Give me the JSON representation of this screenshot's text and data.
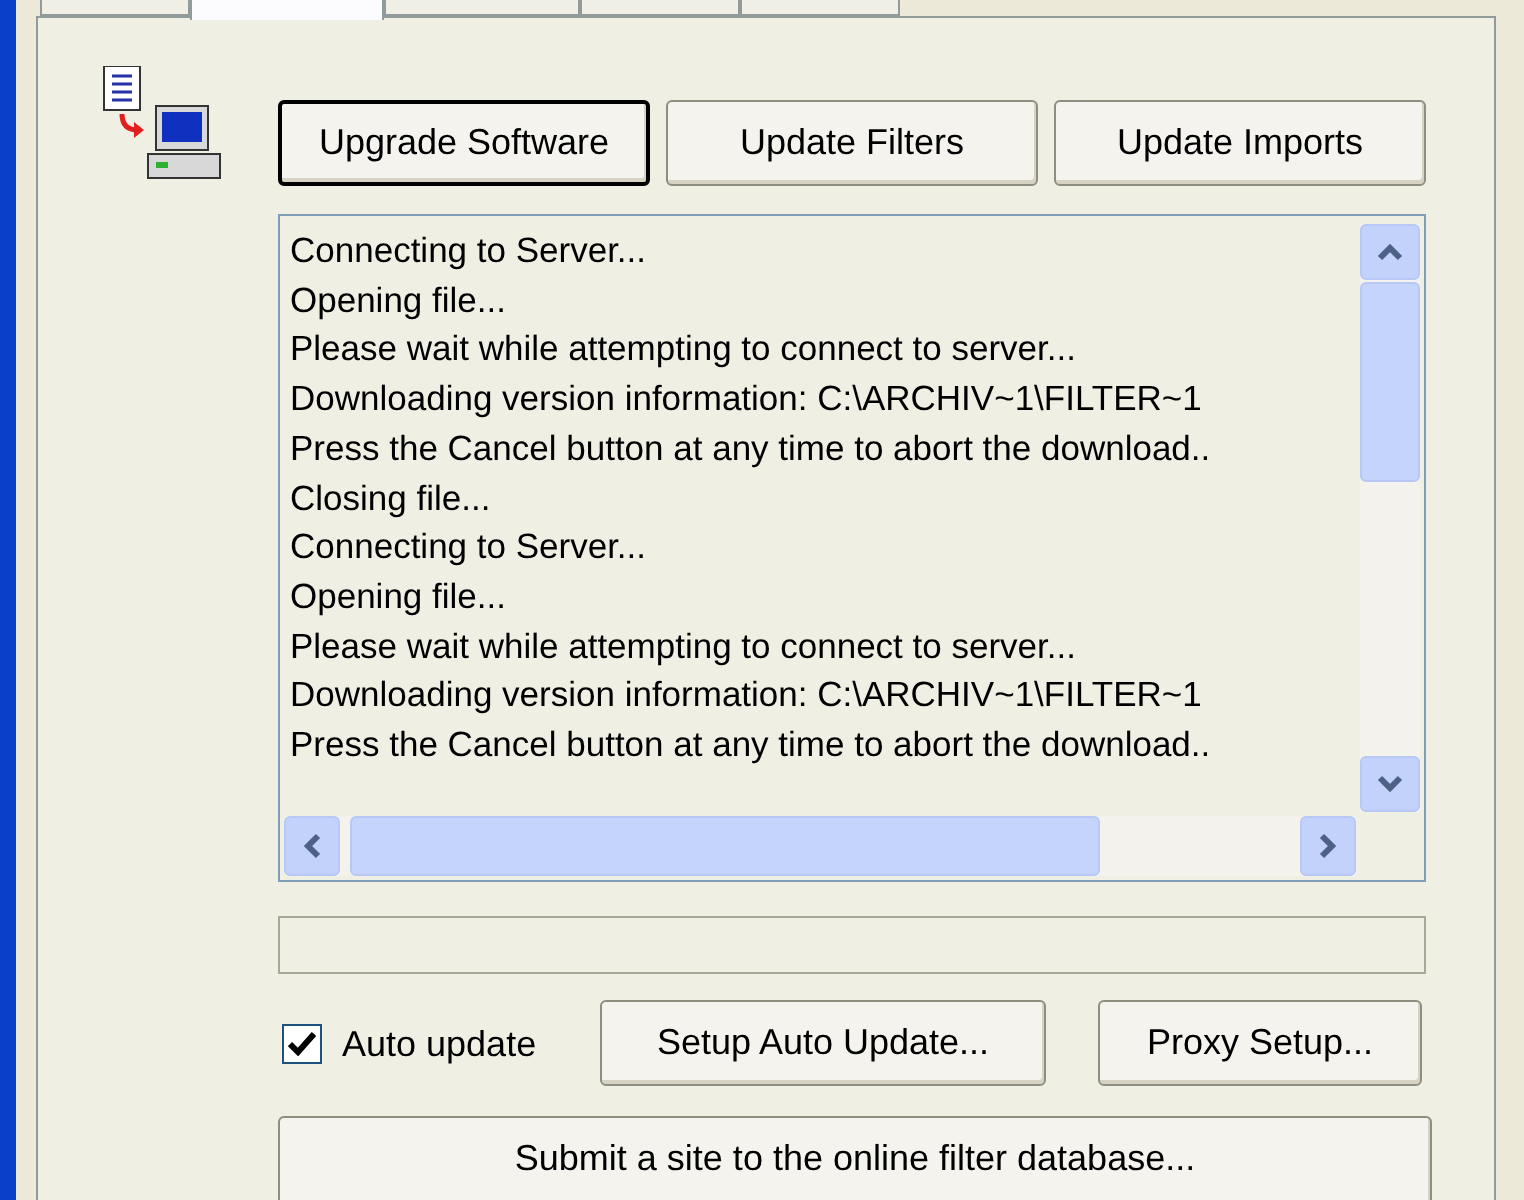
{
  "tabs": [
    {
      "selected": false
    },
    {
      "selected": true
    },
    {
      "selected": false
    },
    {
      "selected": false
    },
    {
      "selected": false
    }
  ],
  "actions": [
    {
      "label": "Upgrade Software",
      "default": true
    },
    {
      "label": "Update Filters",
      "default": false
    },
    {
      "label": "Update Imports",
      "default": false
    }
  ],
  "log": [
    "Connecting to Server...",
    "Opening file...",
    "Please wait while attempting to connect to server...",
    "Downloading version information: C:\\ARCHIV~1\\FILTER~1",
    "Press the Cancel button at any time to abort the download..",
    "Closing file...",
    "Connecting to Server...",
    "Opening file...",
    "Please wait while attempting to connect to server...",
    "Downloading version information: C:\\ARCHIV~1\\FILTER~1",
    "Press the Cancel button at any time to abort the download.."
  ],
  "auto_update": {
    "label": "Auto update",
    "checked": true
  },
  "buttons": [
    "Setup Auto Update...",
    "Proxy Setup..."
  ],
  "submit_button": "Submit a site to the online filter database..."
}
